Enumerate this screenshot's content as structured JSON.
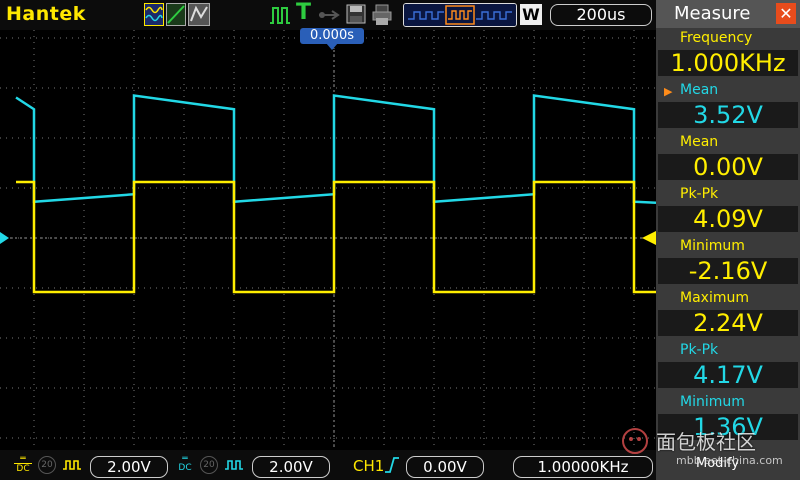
{
  "topbar": {
    "brand": "Hantek",
    "timebase": "200us",
    "wave_mode": "W"
  },
  "trigger_position": "0.000s",
  "channels": {
    "ch1_color": "#ffee00",
    "ch2_color": "#22d8e6"
  },
  "measure": {
    "title": "Measure",
    "items": [
      {
        "label": "Frequency",
        "value": "1.000KHz",
        "label_color": "#ffee00",
        "value_color": "#ffee00"
      },
      {
        "label": "Mean",
        "value": "3.52V",
        "label_color": "#22d8e6",
        "value_color": "#22d8e6",
        "selected": true
      },
      {
        "label": "Mean",
        "value": "0.00V",
        "label_color": "#ffee00",
        "value_color": "#ffee00"
      },
      {
        "label": "Pk-Pk",
        "value": "4.09V",
        "label_color": "#ffee00",
        "value_color": "#ffee00"
      },
      {
        "label": "Minimum",
        "value": "-2.16V",
        "label_color": "#ffee00",
        "value_color": "#ffee00"
      },
      {
        "label": "Maximum",
        "value": "2.24V",
        "label_color": "#ffee00",
        "value_color": "#ffee00"
      },
      {
        "label": "Pk-Pk",
        "value": "4.17V",
        "label_color": "#22d8e6",
        "value_color": "#22d8e6"
      },
      {
        "label": "Minimum",
        "value": "1.36V",
        "label_color": "#22d8e6",
        "value_color": "#22d8e6"
      }
    ],
    "modify": "Modify"
  },
  "bottombar": {
    "ch1_coupling": "DC",
    "ch1_probe": "20",
    "ch1_scale": "2.00V",
    "ch2_coupling": "DC",
    "ch2_probe": "20",
    "ch2_scale": "2.00V",
    "trig_source": "CH1",
    "trig_level": "0.00V",
    "trig_freq": "1.00000KHz"
  },
  "watermark": {
    "text": "面包板社区",
    "url": "mbb.eet-china.com"
  }
}
